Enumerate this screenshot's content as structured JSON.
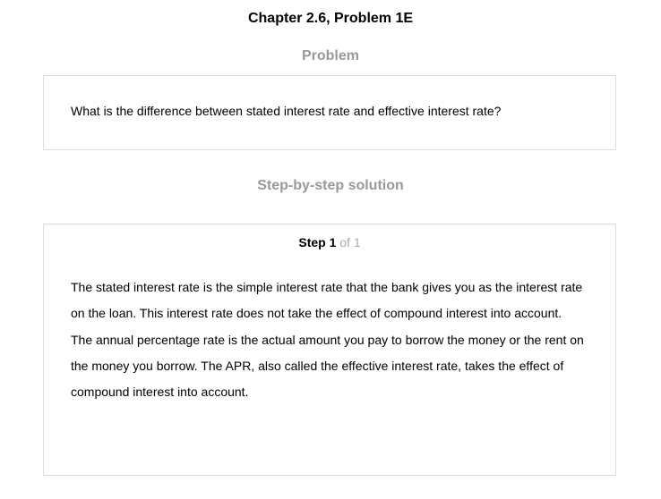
{
  "header": {
    "title": "Chapter 2.6, Problem 1E"
  },
  "problem": {
    "heading": "Problem",
    "text": "What is the difference between stated interest rate and effective interest rate?"
  },
  "solution": {
    "heading": "Step-by-step solution",
    "step_label": "Step 1",
    "step_of": "of 1",
    "paragraphs": [
      "The stated interest rate is the simple interest rate that the bank gives you as the interest rate on the loan. This interest rate does not take the effect of compound interest into account.",
      "The annual percentage rate is the actual amount you pay to borrow the money or the rent on the money you borrow. The APR, also called the effective interest rate, takes the effect of compound interest into account."
    ]
  }
}
